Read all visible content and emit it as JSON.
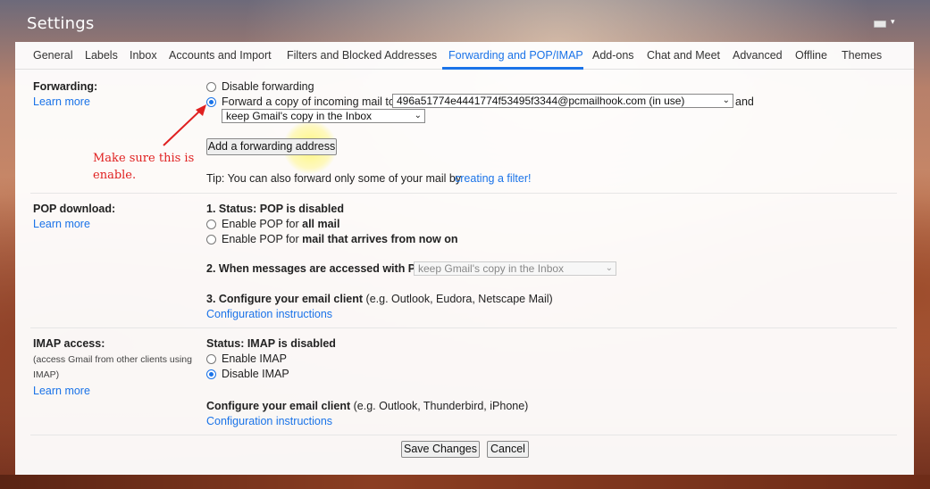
{
  "header": {
    "title": "Settings"
  },
  "tabs": [
    {
      "label": "General"
    },
    {
      "label": "Labels"
    },
    {
      "label": "Inbox"
    },
    {
      "label": "Accounts and Import"
    },
    {
      "label": "Filters and Blocked Addresses"
    },
    {
      "label": "Forwarding and POP/IMAP",
      "active": true
    },
    {
      "label": "Add-ons"
    },
    {
      "label": "Chat and Meet"
    },
    {
      "label": "Advanced"
    },
    {
      "label": "Offline"
    },
    {
      "label": "Themes"
    }
  ],
  "forwarding": {
    "label": "Forwarding:",
    "learn_more": "Learn more",
    "disable_option": "Disable forwarding",
    "forward_option": "Forward a copy of incoming mail to",
    "forward_address": "496a51774e4441774f53495f3344@pcmailhook.com (in use)",
    "and_text": "and",
    "copy_action": "keep Gmail's copy in the Inbox",
    "add_button": "Add a forwarding address",
    "tip_text": "Tip: You can also forward only some of your mail by",
    "tip_link": "creating a filter!"
  },
  "annotation": {
    "line1": "Make sure this is",
    "line2": "enable.",
    "color": "#e02020"
  },
  "pop": {
    "label": "POP download:",
    "learn_more": "Learn more",
    "status": "1. Status: POP is disabled",
    "opt_all_prefix": "Enable POP for",
    "opt_all_bold": "all mail",
    "opt_now_prefix": "Enable POP for",
    "opt_now_bold": "mail that arrives from now on",
    "accessed_label": "2. When messages are accessed with POP",
    "accessed_value": "keep Gmail's copy in the Inbox",
    "configure_bold": "3. Configure your email client",
    "configure_rest": "(e.g. Outlook, Eudora, Netscape Mail)",
    "config_link": "Configuration instructions"
  },
  "imap": {
    "label": "IMAP access:",
    "sub1": "(access Gmail from other clients using",
    "sub2": "IMAP)",
    "learn_more": "Learn more",
    "status": "Status: IMAP is disabled",
    "enable": "Enable IMAP",
    "disable": "Disable IMAP",
    "configure_bold": "Configure your email client",
    "configure_rest": "(e.g. Outlook, Thunderbird, iPhone)",
    "config_link": "Configuration instructions"
  },
  "footer": {
    "save": "Save Changes",
    "cancel": "Cancel"
  },
  "colors": {
    "accent": "#1a73e8",
    "annotation": "#e02020"
  }
}
